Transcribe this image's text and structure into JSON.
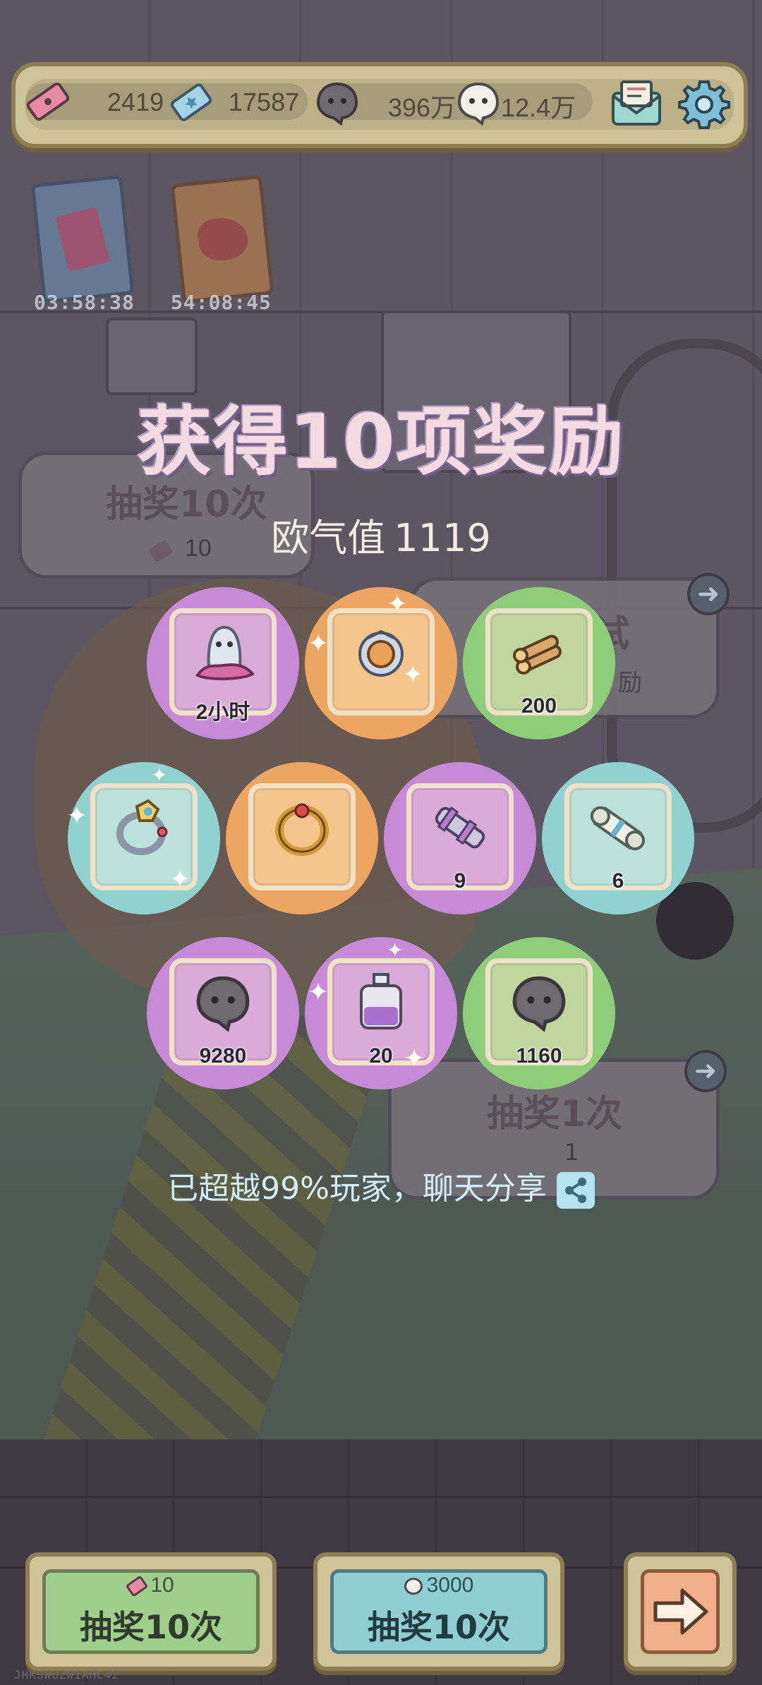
{
  "topbar": {
    "tickets": "2419",
    "vouchers": "17587",
    "ghost_coins": "396万",
    "speech_coins": "12.4万"
  },
  "timers": [
    "03:58:38",
    "54:08:45"
  ],
  "background": {
    "button_top_label": "抽奖10次",
    "button_top_cost": "10",
    "button_mid_label": "试",
    "button_mid_sub": "励",
    "button_low_label": "抽奖1次",
    "button_low_cost": "1"
  },
  "reward_panel": {
    "title": "获得10项奖励",
    "luck_label": "欧气值",
    "luck_value": "1119",
    "rewards": [
      {
        "color": "purple",
        "icon": "ghost-slime-icon",
        "qty": "2小时"
      },
      {
        "color": "orange",
        "icon": "ornament-icon",
        "qty": ""
      },
      {
        "color": "green",
        "icon": "logs-icon",
        "qty": "200"
      },
      {
        "color": "teal",
        "icon": "gem-ring-icon",
        "qty": ""
      },
      {
        "color": "orange",
        "icon": "gold-ring-icon",
        "qty": ""
      },
      {
        "color": "purple",
        "icon": "cannon-icon",
        "qty": "9"
      },
      {
        "color": "teal",
        "icon": "scroll-icon",
        "qty": "6"
      },
      {
        "color": "purple",
        "icon": "speech-bubble-icon",
        "qty": "9280"
      },
      {
        "color": "purple",
        "icon": "potion-icon",
        "qty": "20"
      },
      {
        "color": "green",
        "icon": "speech-bubble-icon",
        "qty": "1160"
      }
    ],
    "share_text": "已超越99%玩家，聊天分享"
  },
  "bottom_buttons": {
    "left": {
      "cost": "10",
      "label": "抽奖10次"
    },
    "middle": {
      "cost": "3000",
      "label": "抽奖10次"
    }
  },
  "watermark": "JHKSWGZW1AHC42",
  "colors": {
    "purple": "#c78ad6",
    "orange": "#eda562",
    "green": "#8fce79",
    "teal": "#8fd2cf"
  }
}
